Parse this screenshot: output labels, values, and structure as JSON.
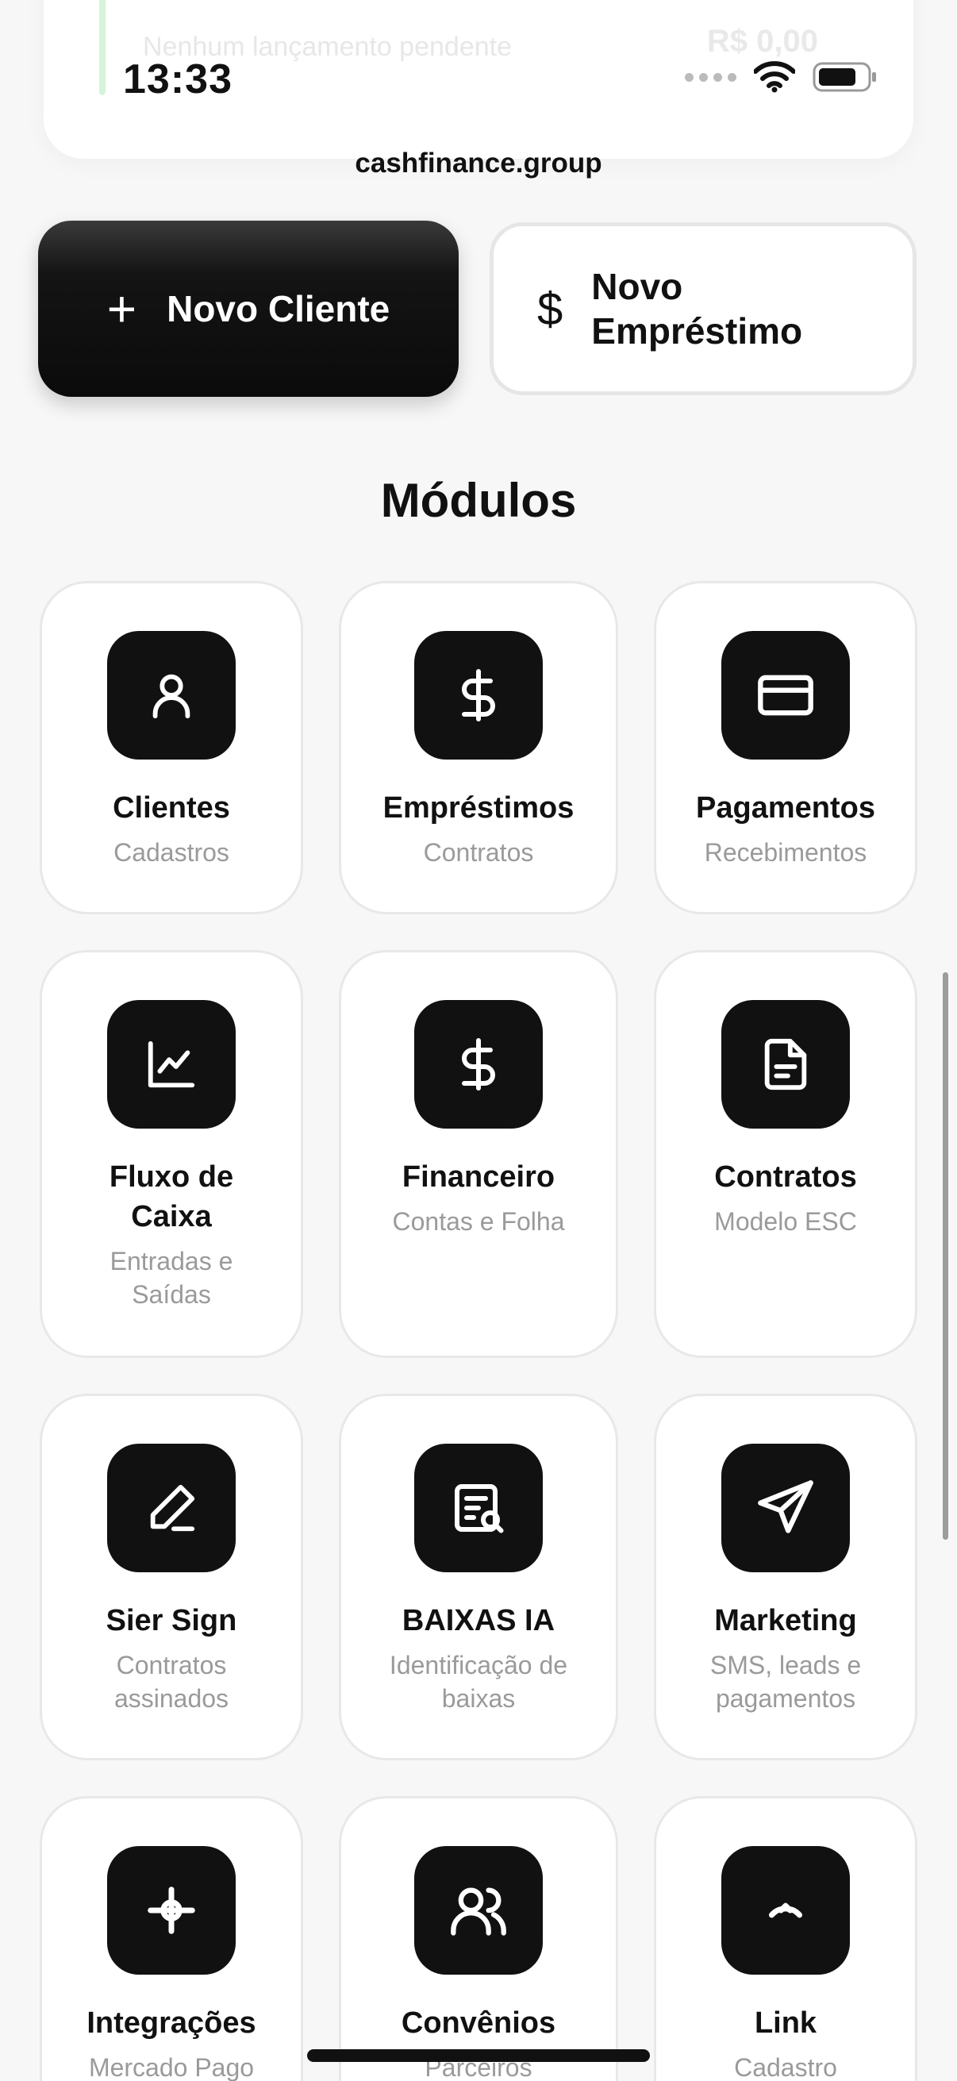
{
  "top_card": {
    "faded_text": "Nenhum lançamento pendente",
    "faded_amount": "R$ 0,00"
  },
  "status_bar": {
    "time": "13:33"
  },
  "url": "cashfinance.group",
  "actions": {
    "new_client": "Novo Cliente",
    "new_loan_line1": "Novo",
    "new_loan_line2": "Empréstimo"
  },
  "section_title": "Módulos",
  "modules": [
    {
      "title": "Clientes",
      "subtitle": "Cadastros",
      "icon": "user-icon"
    },
    {
      "title": "Empréstimos",
      "subtitle": "Contratos",
      "icon": "dollar-icon"
    },
    {
      "title": "Pagamentos",
      "subtitle": "Recebimentos",
      "icon": "credit-card-icon"
    },
    {
      "title": "Fluxo de Caixa",
      "subtitle": "Entradas e Saídas",
      "icon": "chart-line-icon"
    },
    {
      "title": "Financeiro",
      "subtitle": "Contas e Folha",
      "icon": "dollar-icon"
    },
    {
      "title": "Contratos",
      "subtitle": "Modelo ESC",
      "icon": "document-icon"
    },
    {
      "title": "Sier Sign",
      "subtitle": "Contratos assinados",
      "icon": "pen-icon"
    },
    {
      "title": "BAIXAS IA",
      "subtitle": "Identificação de baixas",
      "icon": "receipt-search-icon"
    },
    {
      "title": "Marketing",
      "subtitle": "SMS, leads e pagamentos",
      "icon": "send-icon"
    },
    {
      "title": "Integrações",
      "subtitle": "Mercado Pago",
      "icon": "crosshair-icon"
    },
    {
      "title": "Convênios",
      "subtitle": "Parceiros",
      "icon": "users-icon"
    },
    {
      "title": "Link",
      "subtitle": "Cadastro",
      "icon": "link-icon"
    }
  ]
}
